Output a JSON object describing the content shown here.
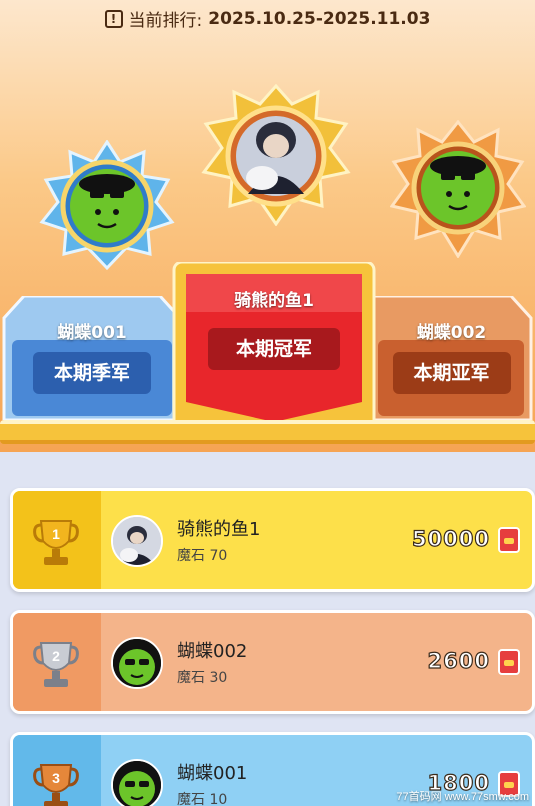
{
  "header": {
    "period_label": "当前排行:",
    "period_range": "2025.10.25-2025.11.03",
    "warn_icon": "!"
  },
  "podium": {
    "first": {
      "name": "骑熊的鱼1",
      "title": "本期冠军"
    },
    "second": {
      "name": "蝴蝶002",
      "title": "本期亚军"
    },
    "third": {
      "name": "蝴蝶001",
      "title": "本期季军"
    }
  },
  "leaderboard": [
    {
      "rank": "1",
      "name": "骑熊的鱼1",
      "sub": "魔石 70",
      "score": "50000",
      "band": "#f3c21a",
      "bg": "#fde04a",
      "trophy": "gold"
    },
    {
      "rank": "2",
      "name": "蝴蝶002",
      "sub": "魔石 30",
      "score": "2600",
      "band": "#f09a63",
      "bg": "#f4b48a",
      "trophy": "silver"
    },
    {
      "rank": "3",
      "name": "蝴蝶001",
      "sub": "魔石 10",
      "score": "1800",
      "band": "#62b9ea",
      "bg": "#8fd0f4",
      "trophy": "bronze"
    }
  ],
  "watermark": "77首码网 www.77smw.com",
  "colors": {
    "gold": "#f6c33b",
    "red_podium": "#e8262b",
    "blue_podium": "#4a88d6",
    "brown_podium": "#c9602f"
  }
}
